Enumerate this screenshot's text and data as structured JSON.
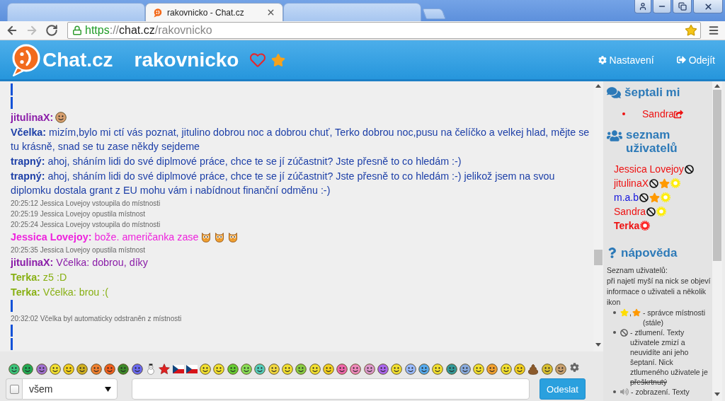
{
  "browser": {
    "tabs": [
      {
        "selected": false
      },
      {
        "title": "rakovnicko - Chat.cz",
        "selected": true
      },
      {
        "selected": false
      }
    ],
    "nav": [
      {
        "kind": "back",
        "disabled": false
      },
      {
        "kind": "forward",
        "disabled": true
      },
      {
        "kind": "reload",
        "disabled": false
      }
    ],
    "url": {
      "scheme": "https",
      "separator": "://",
      "host": "chat.cz",
      "path": "/rakovnicko"
    },
    "bookmarked": true
  },
  "header": {
    "logo": "Chat.cz",
    "room": "rakovnicko",
    "liked": false,
    "starred": true,
    "menu": [
      {
        "kind": "settings",
        "label": "Nastavení"
      },
      {
        "kind": "logout",
        "label": "Odejít"
      }
    ]
  },
  "chat": {
    "messages": [
      {
        "kind": "marker"
      },
      {
        "kind": "marker"
      },
      {
        "kind": "message",
        "nick": "jitulinaX:",
        "color": "#8a1ca8",
        "emoticons": [
          {
            "kind": "face"
          }
        ]
      },
      {
        "kind": "message",
        "nick": "Včelka:",
        "text": "mizím,bylo mi ctí vás poznat, jitulino dobrou noc a dobrou chuť, Terko dobrou noc,pusu na čelíčko a velkej hlad, mějte se tu krásně, snad se tu zase někdy sejdeme",
        "color": "#1e40a8"
      },
      {
        "kind": "message",
        "nick": "trapný:",
        "text": "ahoj, sháním lidi do své diplmové práce, chce te se jí zúčastnit? Jste přesně to co hledám :-)",
        "color": "#1e40a8"
      },
      {
        "kind": "message",
        "nick": "trapný:",
        "text": "ahoj, sháním lidi do své diplmové práce, chce te se jí zúčastnit? Jste přesně to co hledám :-) jelikož jsem na svou diplomku dostala grant z EU mohu vám i nabídnout finanční odměnu :-)",
        "color": "#1e40a8"
      },
      {
        "kind": "event",
        "text": "20:25:12 Jessica Lovejoy vstoupila do místnosti"
      },
      {
        "kind": "event",
        "text": "20:25:19 Jessica Lovejoy opustila místnost"
      },
      {
        "kind": "event",
        "text": "20:25:24 Jessica Lovejoy vstoupila do místnosti"
      },
      {
        "kind": "message",
        "nick": "Jessica Lovejoy:",
        "text": "bože. američanka zase",
        "color": "#ee22dd",
        "emoticons": [
          {
            "kind": "owl"
          },
          {
            "kind": "owl"
          },
          {
            "kind": "owl"
          }
        ]
      },
      {
        "kind": "event",
        "text": "20:25:35 Jessica Lovejoy opustila místnost"
      },
      {
        "kind": "message",
        "nick": "jitulinaX:",
        "text": "Včelka: dobrou, díky",
        "color": "#8a1ca8"
      },
      {
        "kind": "message",
        "nick": "Terka:",
        "text": "z5 :D",
        "color": "#88b014"
      },
      {
        "kind": "message",
        "nick": "Terka:",
        "text": "Včelka: brou :(",
        "color": "#88b014"
      },
      {
        "kind": "marker"
      },
      {
        "kind": "event",
        "text": "20:32:02 Včelka byl automaticky odstraněn z místnosti"
      },
      {
        "kind": "marker"
      },
      {
        "kind": "marker"
      }
    ]
  },
  "sidebar": {
    "whispers": {
      "title": "šeptali mi",
      "items": [
        {
          "name": "Sandra",
          "color": "#ee1111"
        }
      ]
    },
    "users": {
      "title": "seznam uživatelů",
      "items": [
        {
          "name": "Jessica Lovejoy",
          "color": "#ee1111",
          "current": false,
          "badges": [
            {
              "kind": "ban"
            }
          ]
        },
        {
          "name": "jitulinaX",
          "color": "#ee1111",
          "current": false,
          "badges": [
            {
              "kind": "ban"
            },
            {
              "kind": "star"
            },
            {
              "kind": "ring",
              "color": "#ffee00"
            }
          ]
        },
        {
          "name": "m.a.b",
          "color": "#1111dd",
          "current": false,
          "badges": [
            {
              "kind": "ban"
            },
            {
              "kind": "star"
            },
            {
              "kind": "ring",
              "color": "#ffee00"
            }
          ]
        },
        {
          "name": "Sandra",
          "color": "#ee1111",
          "current": false,
          "badges": [
            {
              "kind": "ban"
            },
            {
              "kind": "ring",
              "color": "#ffee00"
            }
          ]
        },
        {
          "name": "Terka",
          "color": "#ee1111",
          "current": true,
          "badges": [
            {
              "kind": "ring",
              "color": "#ff2222"
            }
          ]
        }
      ]
    },
    "help": {
      "title": "nápověda",
      "intro": "Seznam uživatelů:",
      "text": "při najetí myší na nick se objeví informace o uživateli a několik ikon",
      "items": [
        {
          "icons": [
            {
              "kind": "star",
              "color": "#ffdd00"
            },
            {
              "kind": "star",
              "color": "#ff9900"
            }
          ],
          "joiner": ",",
          "text": "- správce místnosti (stále)"
        },
        {
          "icons": [
            {
              "kind": "ban"
            }
          ],
          "text": "- ztlumení. Texty uživatele zmizí a neuvidíte ani jeho šeptaní. Nick ztlumeného uživatele je",
          "struck": "přeškrtnutý"
        },
        {
          "icons": [
            {
              "kind": "speaker"
            }
          ],
          "text": "- zobrazení. Texty"
        }
      ]
    }
  },
  "composer": {
    "private": {
      "checked": false
    },
    "recipient": "všem",
    "send": "Odeslat"
  }
}
